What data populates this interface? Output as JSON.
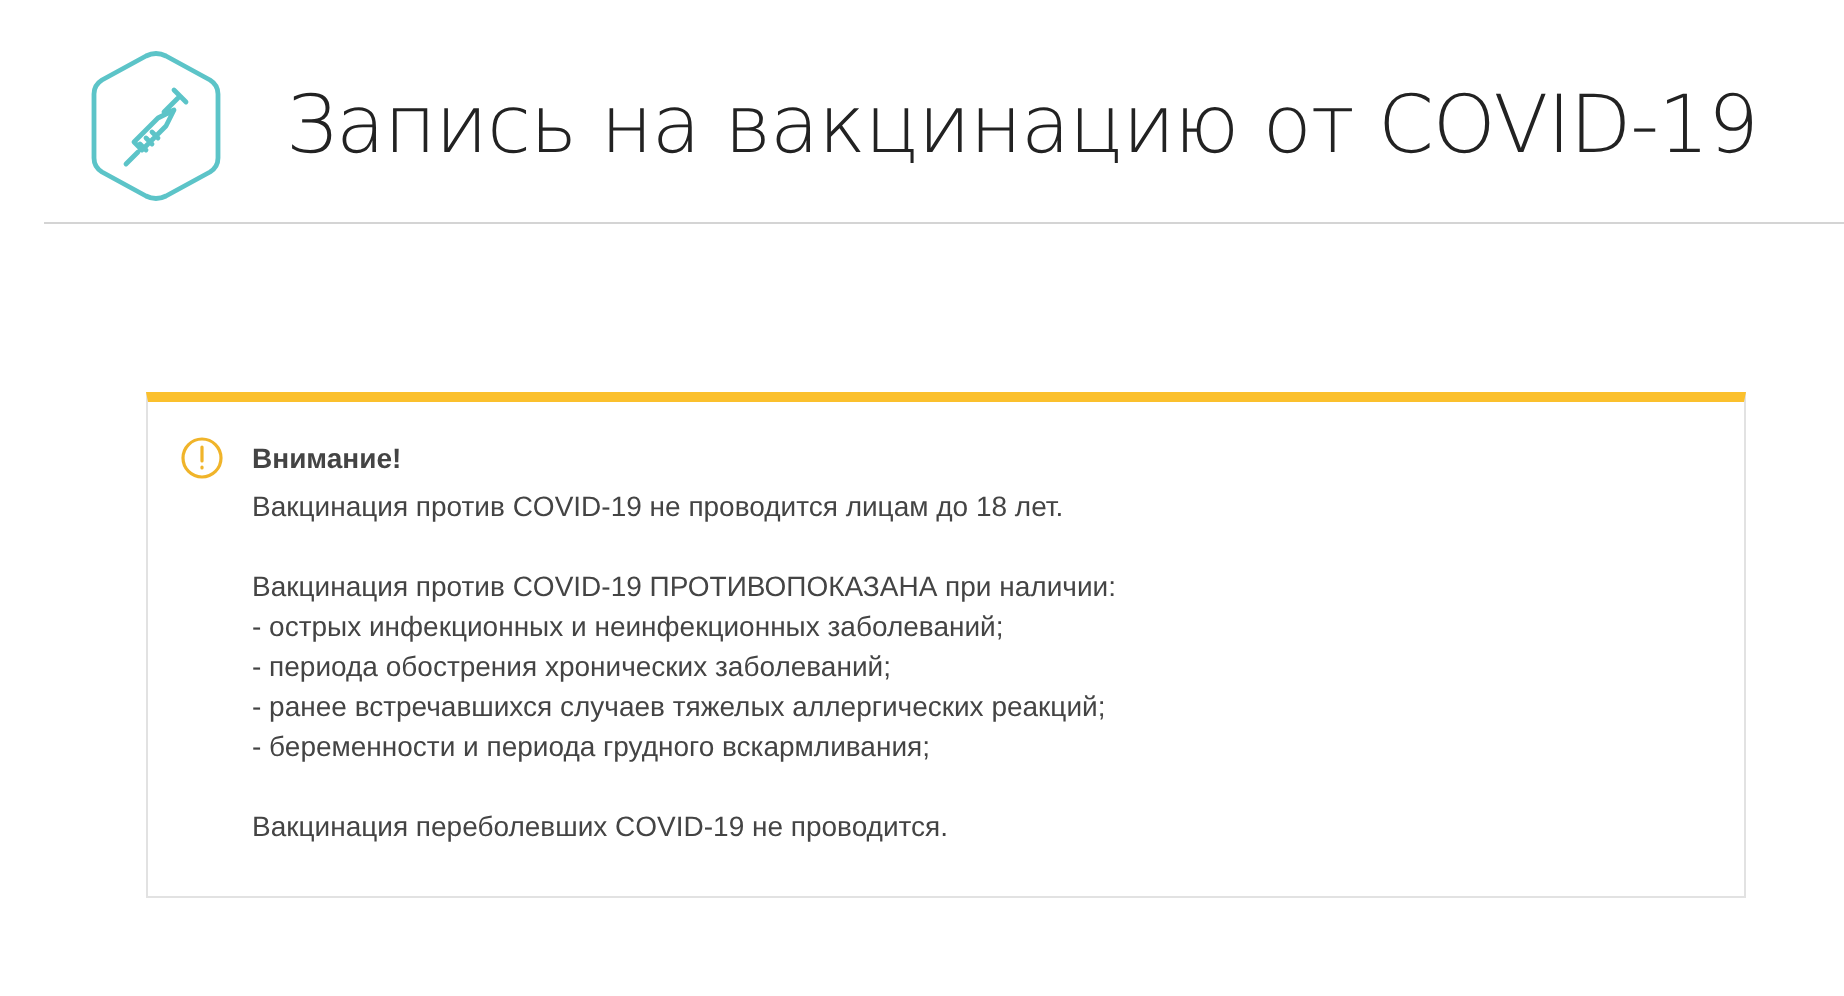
{
  "header": {
    "title": "Запись на вакцинацию от COVID-19"
  },
  "alert": {
    "heading": "Внимание!",
    "paragraphs": [
      {
        "lines": [
          "Вакцинация против COVID-19 не проводится лицам до 18 лет."
        ]
      },
      {
        "lines": [
          "Вакцинация против COVID-19 ПРОТИВОПОКАЗАНА при наличии:",
          "- острых инфекционных и неинфекционных заболеваний;",
          "- периода обострения хронических заболеваний;",
          "- ранее встречавшихся случаев тяжелых аллергических реакций;",
          "- беременности и периода грудного вскармливания;"
        ]
      },
      {
        "lines": [
          "Вакцинация переболевших COVID-19 не проводится."
        ]
      }
    ]
  }
}
